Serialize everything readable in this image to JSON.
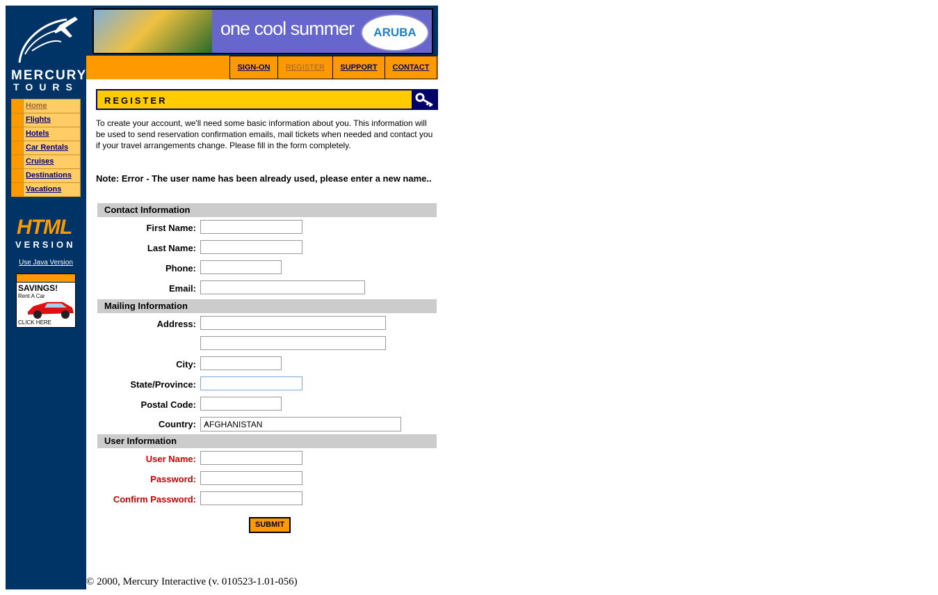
{
  "brand": {
    "line1": "MERCURY",
    "line2": "TOURS"
  },
  "banner": {
    "text": "one cool summer",
    "badge": "ARUBA"
  },
  "topnav": [
    "SIGN-ON",
    "REGISTER",
    "SUPPORT",
    "CONTACT"
  ],
  "sidenav": [
    "Home",
    "Flights",
    "Hotels",
    "Car Rentals",
    "Cruises",
    "Destinations",
    "Vacations"
  ],
  "html_badge": {
    "html": "HTML",
    "version": "VERSION",
    "java_link": "Use Java Version"
  },
  "ad": {
    "title": "SAVINGS!",
    "sub": "Rent A Car",
    "click": "CLICK HERE"
  },
  "page_title": "REGISTER",
  "intro": "To create your account, we'll need some basic information about you. This information will be used to send reservation confirmation emails, mail tickets when needed and contact you if your travel arrangements change. Please fill in the form completely.",
  "note": "Note: Error - The user name has been already used, please enter a new name..",
  "sections": {
    "contact": "Contact Information",
    "mailing": "Mailing Information",
    "user": "User Information"
  },
  "labels": {
    "first_name": "First Name:",
    "last_name": "Last Name:",
    "phone": "Phone:",
    "email": "Email:",
    "address": "Address:",
    "city": "City:",
    "state": "State/Province:",
    "postal": "Postal Code:",
    "country": "Country:",
    "username": "User Name:",
    "password": "Password:",
    "confirm": "Confirm Password:"
  },
  "country_value": "AFGHANISTAN",
  "submit": "SUBMIT",
  "copyright": "© 2000, Mercury Interactive (v. 010523-1.01-056)",
  "colors": {
    "navy": "#003366",
    "orange": "#ff9900",
    "yellow": "#ffcc00",
    "error_red": "#cc0000"
  }
}
